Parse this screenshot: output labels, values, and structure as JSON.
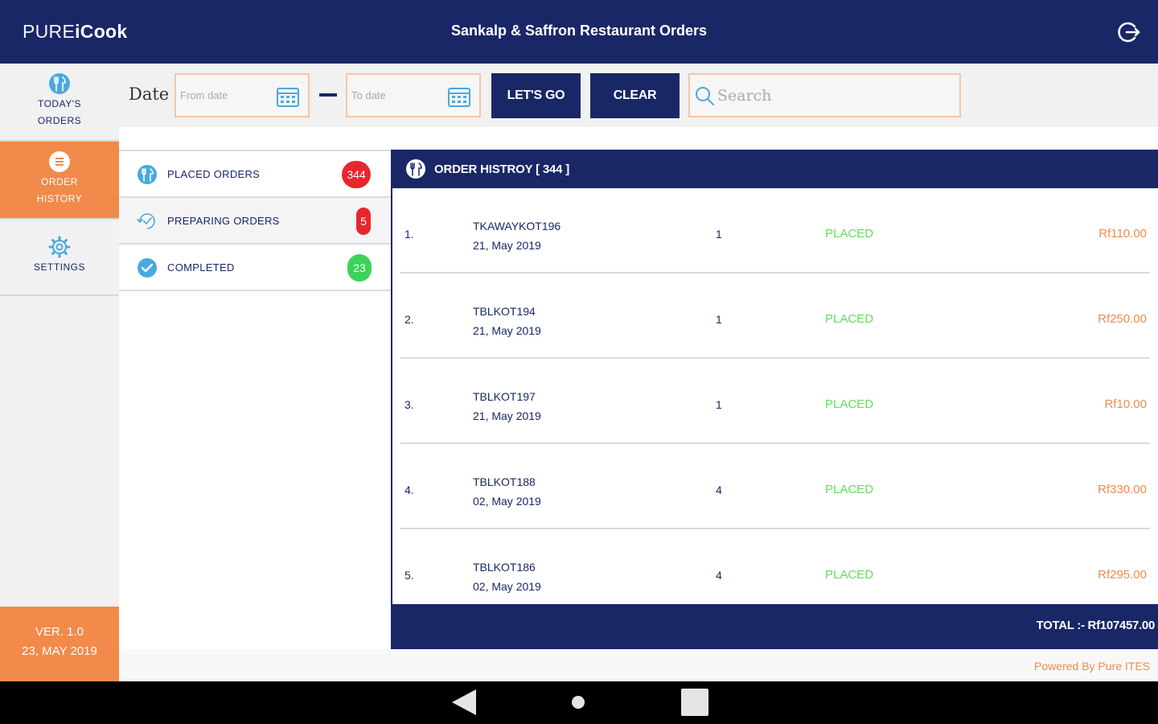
{
  "header": {
    "logo_part1": "PURE",
    "logo_part2": "iCook",
    "title": "Sankalp & Saffron Restaurant Orders",
    "logout_icon": "logout-icon"
  },
  "sidebar": {
    "items": [
      {
        "line1": "TODAY'S",
        "line2": "ORDERS",
        "icon": "restaurant-icon"
      },
      {
        "line1": "ORDER",
        "line2": "HISTORY",
        "icon": "list-icon"
      },
      {
        "line1": "SETTINGS",
        "icon": "gear-icon"
      }
    ],
    "version": "VER. 1.0",
    "version_date": "23, MAY 2019"
  },
  "filter": {
    "date_label": "Date",
    "from_placeholder": "From date",
    "to_placeholder": "To date",
    "go_label": "LET'S GO",
    "clear_label": "CLEAR",
    "search_placeholder": "Search"
  },
  "status": {
    "placed_label": "PLACED ORDERS",
    "placed_count": "344",
    "preparing_label": "PREPARING ORDERS",
    "preparing_count": "5",
    "completed_label": "COMPLETED",
    "completed_count": "23"
  },
  "history": {
    "title": "ORDER HISTROY  [ 344 ]",
    "orders": [
      {
        "num": "1.",
        "code": "TKAWAYKOT196",
        "date": "21, May 2019",
        "qty": "1",
        "status": "PLACED",
        "amount": "Rf110.00"
      },
      {
        "num": "2.",
        "code": "TBLKOT194",
        "date": "21, May 2019",
        "qty": "1",
        "status": "PLACED",
        "amount": "Rf250.00"
      },
      {
        "num": "3.",
        "code": "TBLKOT197",
        "date": "21, May 2019",
        "qty": "1",
        "status": "PLACED",
        "amount": "Rf10.00"
      },
      {
        "num": "4.",
        "code": "TBLKOT188",
        "date": "02, May 2019",
        "qty": "4",
        "status": "PLACED",
        "amount": "Rf330.00"
      },
      {
        "num": "5.",
        "code": "TBLKOT186",
        "date": "02, May 2019",
        "qty": "4",
        "status": "PLACED",
        "amount": "Rf295.00"
      }
    ],
    "total": "TOTAL :- Rf107457.00"
  },
  "footer": {
    "powered": "Powered By Pure ITES"
  },
  "colors": {
    "navy": "#1a2766",
    "orange": "#f28a4b",
    "placed_green": "#5fe05a",
    "badge_red": "#e8262d",
    "badge_green": "#3dd35a"
  }
}
